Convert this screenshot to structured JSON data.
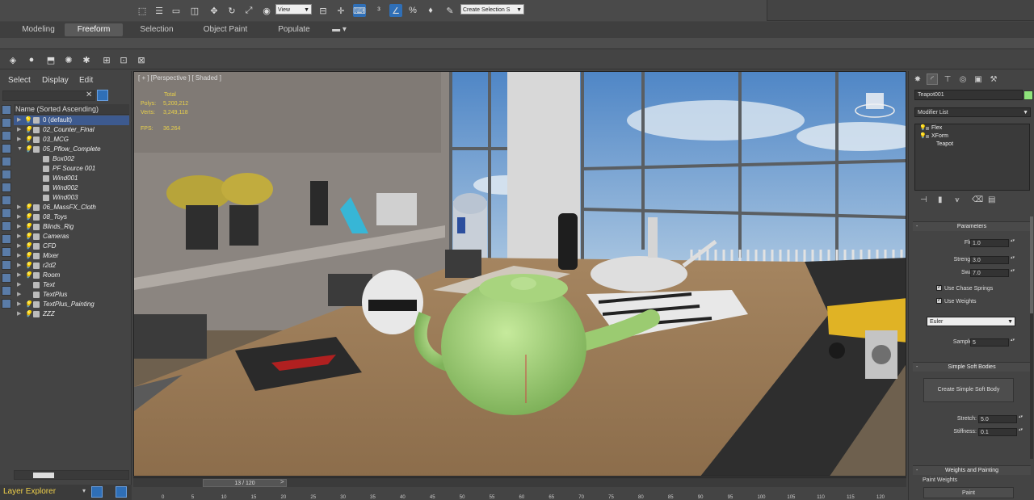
{
  "toolbar": {
    "view_dropdown": "View",
    "selection_set_dropdown": "Create Selection S",
    "icons": [
      "select-object-icon",
      "select-by-name-icon",
      "rectangle-selection-icon",
      "window-crossing-icon",
      "move-icon",
      "rotate-icon",
      "scale-icon",
      "reference-coordinate-icon",
      "pivot-icon",
      "manipulate-icon",
      "snap-icon",
      "angle-snap-icon",
      "percent-snap-icon",
      "spinner-snap-icon"
    ]
  },
  "ribbon": {
    "tabs": [
      "Modeling",
      "Freeform",
      "Selection",
      "Object Paint",
      "Populate"
    ],
    "active_tab": "Freeform"
  },
  "explorer": {
    "menu": [
      "Select",
      "Display",
      "Edit"
    ],
    "column_header": "Name (Sorted Ascending)",
    "layers": [
      {
        "name": "0 (default)",
        "selected": true,
        "depth": 0,
        "bulb": true
      },
      {
        "name": "02_Counter_Final",
        "depth": 0,
        "bulb": true
      },
      {
        "name": "03_MCG",
        "depth": 0,
        "bulb": true
      },
      {
        "name": "05_Pflow_Complete",
        "depth": 0,
        "bulb": true,
        "expanded": true
      },
      {
        "name": "Box002",
        "depth": 1,
        "bulb": false
      },
      {
        "name": "PF Source 001",
        "depth": 1,
        "bulb": false
      },
      {
        "name": "Wind001",
        "depth": 1,
        "bulb": false
      },
      {
        "name": "Wind002",
        "depth": 1,
        "bulb": false
      },
      {
        "name": "Wind003",
        "depth": 1,
        "bulb": false
      },
      {
        "name": "06_MassFX_Cloth",
        "depth": 0,
        "bulb": true
      },
      {
        "name": "08_Toys",
        "depth": 0,
        "bulb": true
      },
      {
        "name": "Blinds_Rig",
        "depth": 0,
        "bulb": true
      },
      {
        "name": "Cameras",
        "depth": 0,
        "bulb": true
      },
      {
        "name": "CFD",
        "depth": 0,
        "bulb": true
      },
      {
        "name": "Mixer",
        "depth": 0,
        "bulb": true
      },
      {
        "name": "r2d2",
        "depth": 0,
        "bulb": true
      },
      {
        "name": "Room",
        "depth": 0,
        "bulb": true
      },
      {
        "name": "Text",
        "depth": 0,
        "bulb": false
      },
      {
        "name": "TextPlus",
        "depth": 0,
        "bulb": false
      },
      {
        "name": "TextPlus_Painting",
        "depth": 0,
        "bulb": true
      },
      {
        "name": "ZZZ",
        "depth": 0,
        "bulb": true
      }
    ],
    "footer_label": "Layer Explorer"
  },
  "viewport": {
    "label": "[ + ] [Perspective ] [ Shaded ]",
    "stats": {
      "total_label": "Total",
      "polys_label": "Polys:",
      "polys": "5,200,212",
      "verts_label": "Verts:",
      "verts": "3,249,118",
      "fps_label": "FPS:",
      "fps": "36.264"
    }
  },
  "timeline": {
    "frame_label": "13 / 120",
    "ticks": [
      "0",
      "5",
      "10",
      "15",
      "20",
      "25",
      "30",
      "35",
      "40",
      "45",
      "50",
      "55",
      "60",
      "65",
      "70",
      "75",
      "80",
      "85",
      "90",
      "95",
      "100",
      "105",
      "110",
      "115",
      "120"
    ]
  },
  "command_panel": {
    "object_name": "Teapot001",
    "color": "#8ee27a",
    "modifier_list": "Modifier List",
    "stack": [
      "Flex",
      "XForm",
      "Teapot"
    ],
    "parameters": {
      "title": "Parameters",
      "flex_label": "Flex:",
      "flex": "1.0",
      "strength_label": "Strength:",
      "strength": "3.0",
      "sway_label": "Sway:",
      "sway": "7.0",
      "chase_springs": "Use Chase Springs",
      "use_weights": "Use Weights",
      "solver": "Euler",
      "samples_label": "Samples:",
      "samples": "5"
    },
    "soft_bodies": {
      "title": "Simple Soft Bodies",
      "button": "Create Simple Soft Body",
      "stretch_label": "Stretch:",
      "stretch": "5.0",
      "stiffness_label": "Stiffness:",
      "stiffness": "0.1"
    },
    "weights": {
      "title": "Weights and Painting",
      "paint_weights": "Paint Weights",
      "paint_button": "Paint"
    }
  }
}
